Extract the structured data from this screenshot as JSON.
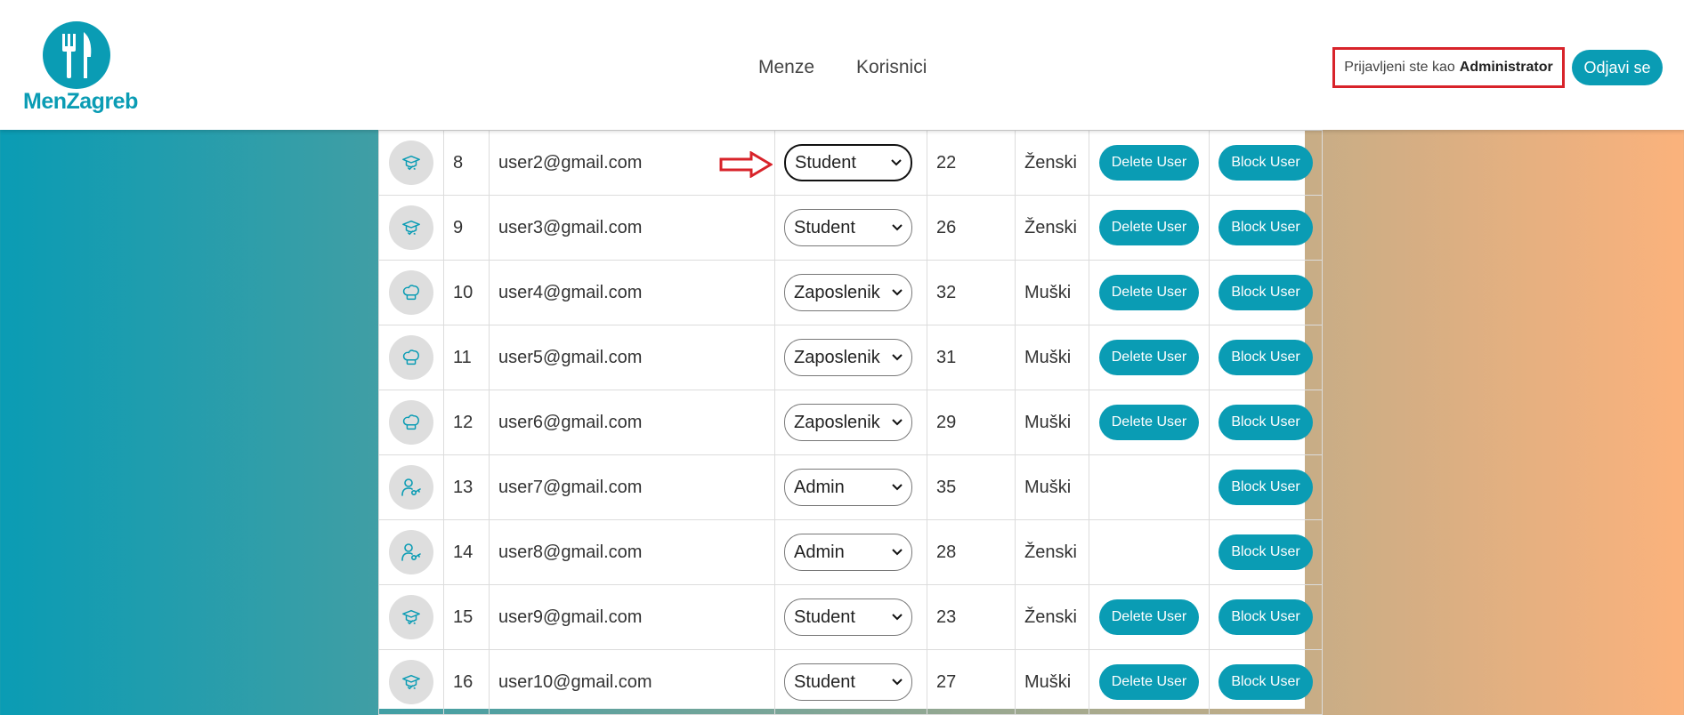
{
  "app": {
    "logo_text": "MenZagreb"
  },
  "nav": {
    "menze": "Menze",
    "korisnici": "Korisnici"
  },
  "session": {
    "prefix": "Prijavljeni ste kao",
    "role": "Administrator",
    "logout": "Odjavi se"
  },
  "actions": {
    "delete": "Delete User",
    "block": "Block User"
  },
  "users": [
    {
      "id": "8",
      "email": "user2@gmail.com",
      "role": "Student",
      "age": "22",
      "gender": "Ženski",
      "icon": "graduation-cap-icon"
    },
    {
      "id": "9",
      "email": "user3@gmail.com",
      "role": "Student",
      "age": "26",
      "gender": "Ženski",
      "icon": "graduation-cap-icon"
    },
    {
      "id": "10",
      "email": "user4@gmail.com",
      "role": "Zaposlenik",
      "age": "32",
      "gender": "Muški",
      "icon": "chef-hat-icon"
    },
    {
      "id": "11",
      "email": "user5@gmail.com",
      "role": "Zaposlenik",
      "age": "31",
      "gender": "Muški",
      "icon": "chef-hat-icon"
    },
    {
      "id": "12",
      "email": "user6@gmail.com",
      "role": "Zaposlenik",
      "age": "29",
      "gender": "Muški",
      "icon": "chef-hat-icon"
    },
    {
      "id": "13",
      "email": "user7@gmail.com",
      "role": "Admin",
      "age": "35",
      "gender": "Muški",
      "icon": "user-key-icon"
    },
    {
      "id": "14",
      "email": "user8@gmail.com",
      "role": "Admin",
      "age": "28",
      "gender": "Ženski",
      "icon": "user-key-icon"
    },
    {
      "id": "15",
      "email": "user9@gmail.com",
      "role": "Student",
      "age": "23",
      "gender": "Ženski",
      "icon": "graduation-cap-icon"
    },
    {
      "id": "16",
      "email": "user10@gmail.com",
      "role": "Student",
      "age": "27",
      "gender": "Muški",
      "icon": "graduation-cap-icon"
    }
  ],
  "colors": {
    "accent": "#0a9cb4",
    "highlight": "#d8232a"
  }
}
